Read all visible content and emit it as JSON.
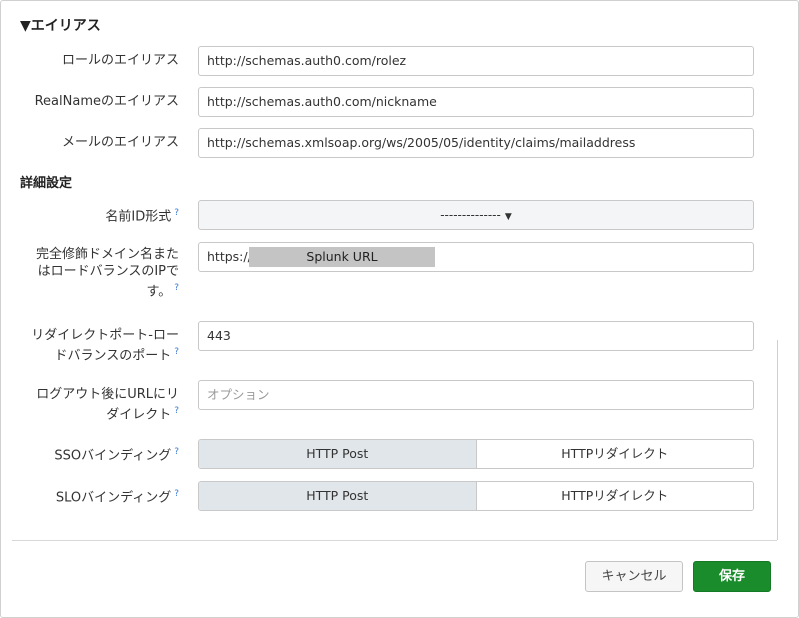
{
  "section": {
    "title": "▼エイリアス"
  },
  "alias": {
    "role_label": "ロールのエイリアス",
    "role_value": "http://schemas.auth0.com/rolez",
    "realname_label": "RealNameのエイリアス",
    "realname_value": "http://schemas.auth0.com/nickname",
    "mail_label": "メールのエイリアス",
    "mail_value": "http://schemas.xmlsoap.org/ws/2005/05/identity/claims/mailaddress"
  },
  "advanced": {
    "title": "詳細設定",
    "nameid_label": "名前ID形式",
    "nameid_value": "--------------",
    "fqdn_label_line1": "完全修飾ドメイン名また",
    "fqdn_label_line2": "はロードバランスのIPで",
    "fqdn_label_line3": "す。",
    "fqdn_prefix": "https://",
    "fqdn_redacted": "Splunk URL",
    "port_label_line1": "リダイレクトポート-ロー",
    "port_label_line2": "ドバランスのポート",
    "port_value": "443",
    "logout_label_line1": "ログアウト後にURLにリ",
    "logout_label_line2": "ダイレクト",
    "logout_placeholder": "オプション",
    "sso_label": "SSOバインディング",
    "slo_label": "SLOバインディング",
    "binding_post": "HTTP Post",
    "binding_redirect": "HTTPリダイレクト",
    "help_mark": "?"
  },
  "footer": {
    "cancel": "キャンセル",
    "save": "保存"
  }
}
